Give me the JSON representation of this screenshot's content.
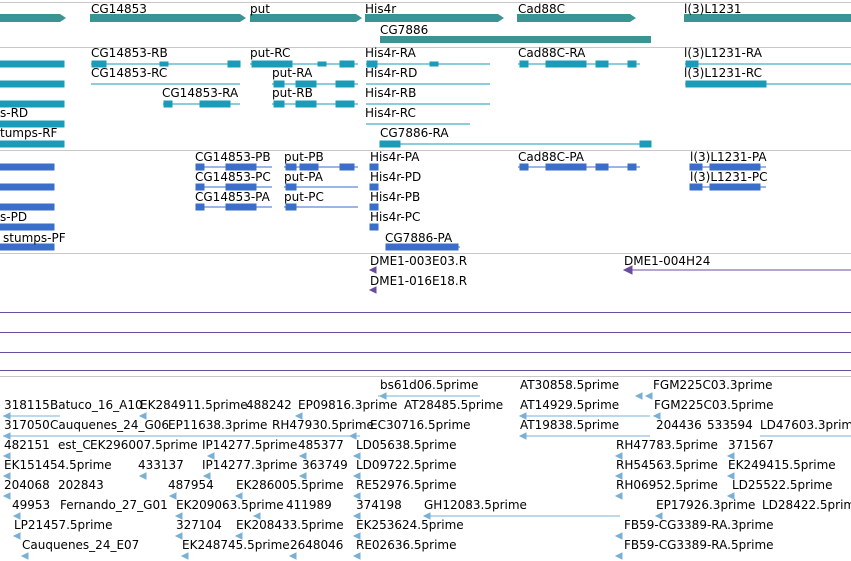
{
  "gene_track": {
    "color": "#3a9494",
    "labels": [
      "CG14853",
      "put",
      "His4r",
      "Cad88C",
      "l(3)L1231",
      "CG7886"
    ]
  },
  "mrna_track": {
    "color": "#1a9bb8",
    "labels": [
      "CG14853-RB",
      "put-RC",
      "His4r-RA",
      "Cad88C-RA",
      "l(3)L1231-RA",
      "CG14853-RC",
      "put-RA",
      "His4r-RD",
      "l(3)L1231-RC",
      "CG14853-RA",
      "put-RB",
      "His4r-RB",
      "s-RD",
      "His4r-RC",
      "tumps-RF",
      "CG7886-RA"
    ]
  },
  "protein_track": {
    "color": "#3a6ec8",
    "labels": [
      "CG14853-PB",
      "put-PB",
      "His4r-PA",
      "Cad88C-PA",
      "l(3)L1231-PA",
      "CG14853-PC",
      "put-PA",
      "His4r-PD",
      "l(3)L1231-PC",
      "CG14853-PA",
      "put-PC",
      "His4r-PB",
      "s-PD",
      "His4r-PC",
      "stumps-PF",
      "CG7886-PA"
    ]
  },
  "clone_track": {
    "color": "#6a4c9c",
    "labels": [
      "DME1-003E03.R",
      "DME1-004H24",
      "DME1-016E18.R"
    ]
  },
  "est_track": {
    "color": "#7ab0d4",
    "labels": [
      "bs61d06.5prime",
      "AT30858.5prime",
      "FGM225C03.3prime",
      "318115",
      "Batuco_16_A10",
      "EK284911.5prime",
      "488242",
      "EP09816.3prime",
      "AT28485.5prime",
      "AT14929.5prime",
      "FGM225C03.5prime",
      "317050",
      "Cauquenes_24_G06",
      "EP11638.3prime",
      "RH47930.5prime",
      "EC30716.5prime",
      "AT19838.5prime",
      "204436",
      "533594",
      "LD47603.3prime",
      "482151",
      "est_C",
      "EK296007.5prime",
      "IP14277.5prime",
      "485377",
      "LD05638.5prime",
      "RH47783.5prime",
      "371567",
      "EK151454.5prime",
      "433137",
      "IP14277.3prime",
      "363749",
      "LD09722.5prime",
      "RH54563.5prime",
      "EK249415.5prime",
      "204068",
      "202843",
      "487954",
      "EK286005.5prime",
      "RE52976.5prime",
      "RH06952.5prime",
      "LD25522.5prime",
      "49953",
      "Fernando_27_G01",
      "EK209063.5prime",
      "411989",
      "374198",
      "GH12083.5prime",
      "EP17926.3prime",
      "LD28422.5prime",
      "LP21457.5prime",
      "327104",
      "EK208433.5prime",
      "EK253624.5prime",
      "FB59-CG3389-RA.3prime",
      "Cauquenes_24_E07",
      "EK248745.5prime",
      "2648046",
      "RE02636.5prime",
      "FB59-CG3389-RA.5prime"
    ]
  }
}
